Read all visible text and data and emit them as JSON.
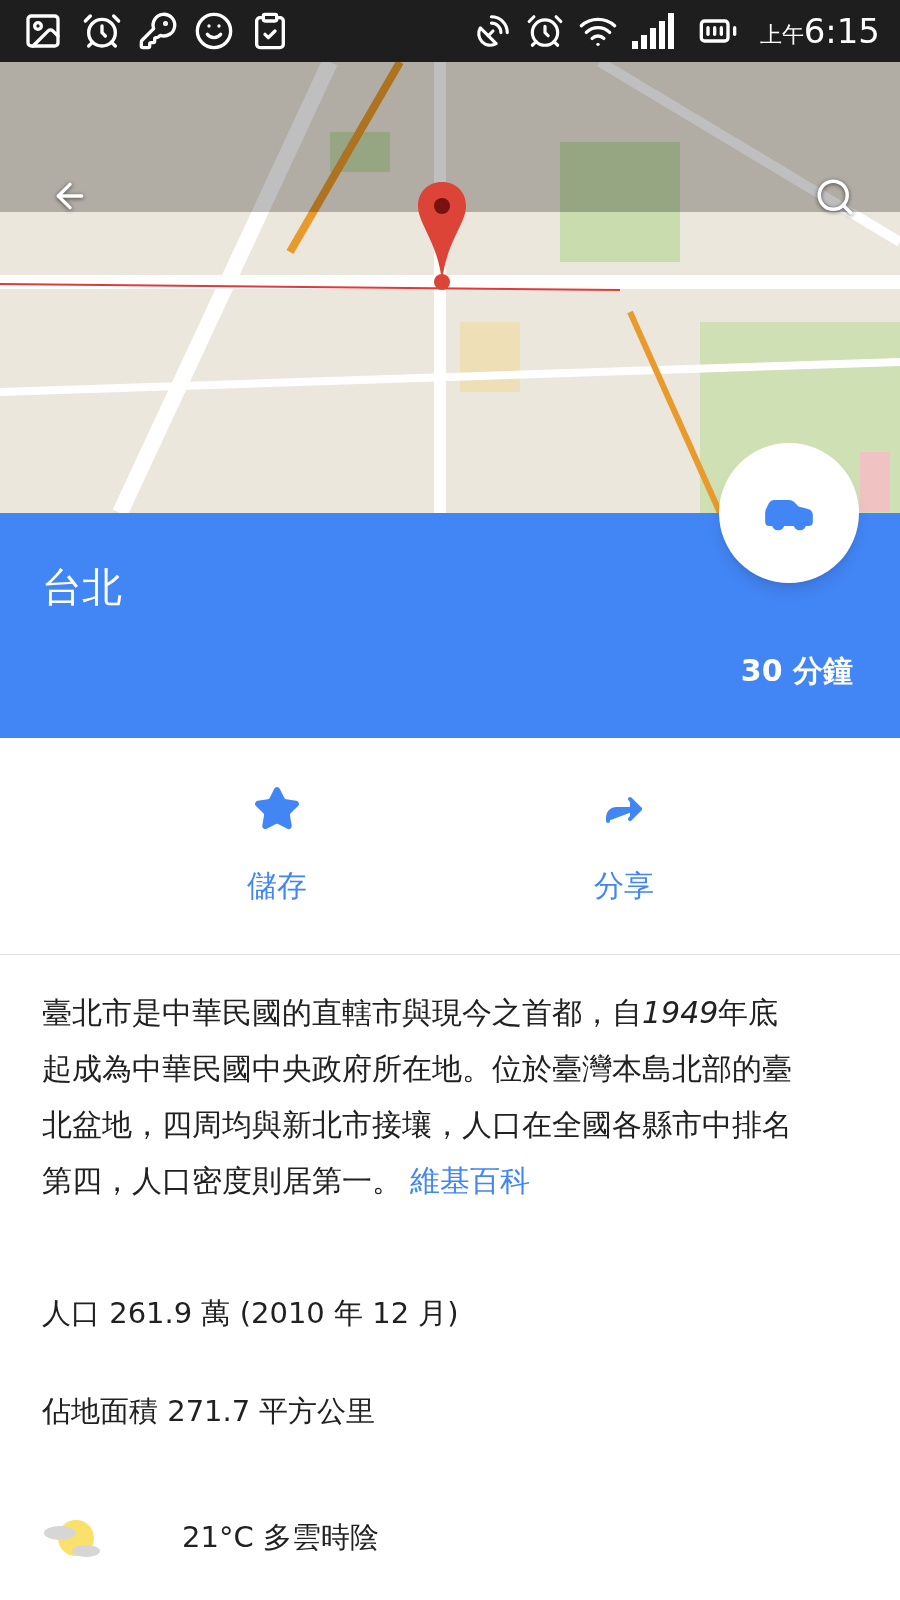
{
  "status_bar": {
    "period": "上午",
    "time": "6:15"
  },
  "place": {
    "title": "台北",
    "travel_time": "30 分鐘"
  },
  "actions": [
    {
      "kind": "save",
      "label": "儲存"
    },
    {
      "kind": "share",
      "label": "分享"
    }
  ],
  "description": {
    "text_before": "臺北市是中華民國的直轄市與現今之首都，自",
    "italic_part": "1949",
    "text_after": "年底起成為中華民國中央政府所在地。位於臺灣本島北部的臺北盆地，四周均與新北市接壤，人口在全國各縣市中排名第四，人口密度則居第一。",
    "source_link": "維基百科"
  },
  "facts": [
    {
      "kind": "population",
      "text": "人口 261.9 萬 (2010 年 12 月)"
    },
    {
      "kind": "area",
      "text": "佔地面積 271.7 平方公里"
    },
    {
      "kind": "weather",
      "text": "21°C 多雲時陰"
    }
  ]
}
